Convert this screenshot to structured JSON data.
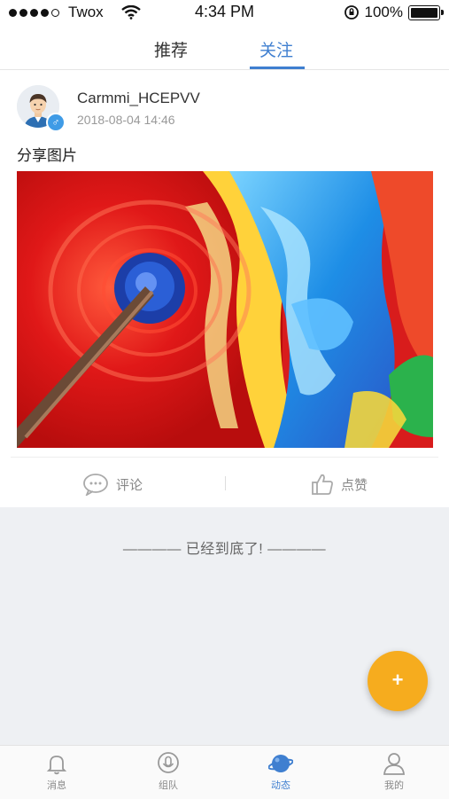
{
  "status_bar": {
    "carrier": "Twox",
    "time": "4:34 PM",
    "battery_label": "100%",
    "battery_level": 1.0,
    "signal_bars": 4
  },
  "tabs": [
    {
      "label": "推荐",
      "active": false
    },
    {
      "label": "关注",
      "active": true
    }
  ],
  "post": {
    "username": "Carmmi_HCEPVV",
    "timestamp": "2018-08-04 14:46",
    "text": "分享图片",
    "comment_label": "评论",
    "like_label": "点赞"
  },
  "end_note": "———— 已经到底了! ————",
  "fab_label": "+",
  "bottom_nav": [
    {
      "label": "消息",
      "icon": "bell-icon",
      "active": false
    },
    {
      "label": "组队",
      "icon": "mic-icon",
      "active": false
    },
    {
      "label": "动态",
      "icon": "planet-icon",
      "active": true
    },
    {
      "label": "我的",
      "icon": "person-icon",
      "active": false
    }
  ],
  "colors": {
    "accent": "#3f7fd0",
    "fab": "#f6ac1e",
    "background": "#eef0f3"
  }
}
